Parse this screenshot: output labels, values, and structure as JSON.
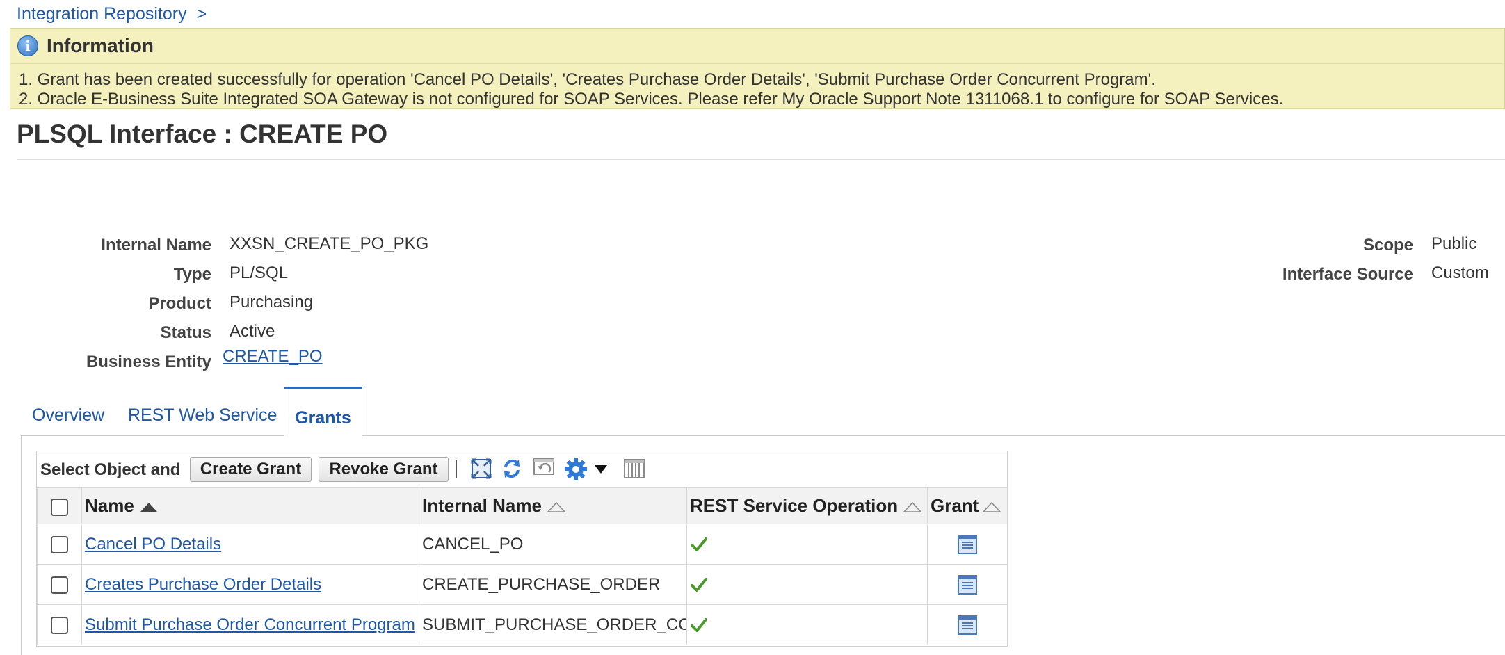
{
  "breadcrumb": {
    "link": "Integration Repository",
    "separator": ">"
  },
  "info": {
    "title": "Information",
    "messages": [
      "1. Grant has been created successfully for operation 'Cancel PO Details', 'Creates Purchase Order Details', 'Submit Purchase Order Concurrent Program'.",
      "2. Oracle E-Business Suite Integrated SOA Gateway is not configured for SOAP Services. Please refer My Oracle Support Note 1311068.1 to configure for SOAP Services."
    ]
  },
  "page": {
    "title": "PLSQL Interface : CREATE PO"
  },
  "properties": {
    "left": [
      {
        "label": "Internal Name",
        "value": "XXSN_CREATE_PO_PKG"
      },
      {
        "label": "Type",
        "value": "PL/SQL"
      },
      {
        "label": "Product",
        "value": "Purchasing"
      },
      {
        "label": "Status",
        "value": "Active"
      },
      {
        "label": "Business Entity",
        "value": "CREATE_PO"
      }
    ],
    "right": [
      {
        "label": "Scope",
        "value": "Public"
      },
      {
        "label": "Interface Source",
        "value": "Custom"
      }
    ]
  },
  "tabs": [
    {
      "label": "Overview",
      "selected": false
    },
    {
      "label": "REST Web Service",
      "selected": false
    },
    {
      "label": "Grants",
      "selected": true
    }
  ],
  "toolbar": {
    "label": "Select Object and",
    "create_grant": "Create Grant",
    "revoke_grant": "Revoke Grant",
    "icons": [
      "detach-icon",
      "refresh-icon",
      "undo-icon",
      "settings-gear-icon",
      "dropdown-arrow-icon",
      "freeze-columns-icon"
    ]
  },
  "table": {
    "columns": [
      "Name",
      "Internal Name",
      "REST Service Operation",
      "Grant"
    ],
    "rows": [
      {
        "name": "Cancel PO Details",
        "internal_name": "CANCEL_PO",
        "rest_operation": true
      },
      {
        "name": "Creates Purchase Order Details",
        "internal_name": "CREATE_PURCHASE_ORDER",
        "rest_operation": true
      },
      {
        "name": "Submit Purchase Order Concurrent Program",
        "internal_name": "SUBMIT_PURCHASE_ORDER_CC",
        "rest_operation": true
      }
    ]
  },
  "colors": {
    "link": "#1f58a6",
    "info_background": "#f4f1bf",
    "check": "#4a9a2c",
    "tab_accent": "#2e6db8"
  }
}
